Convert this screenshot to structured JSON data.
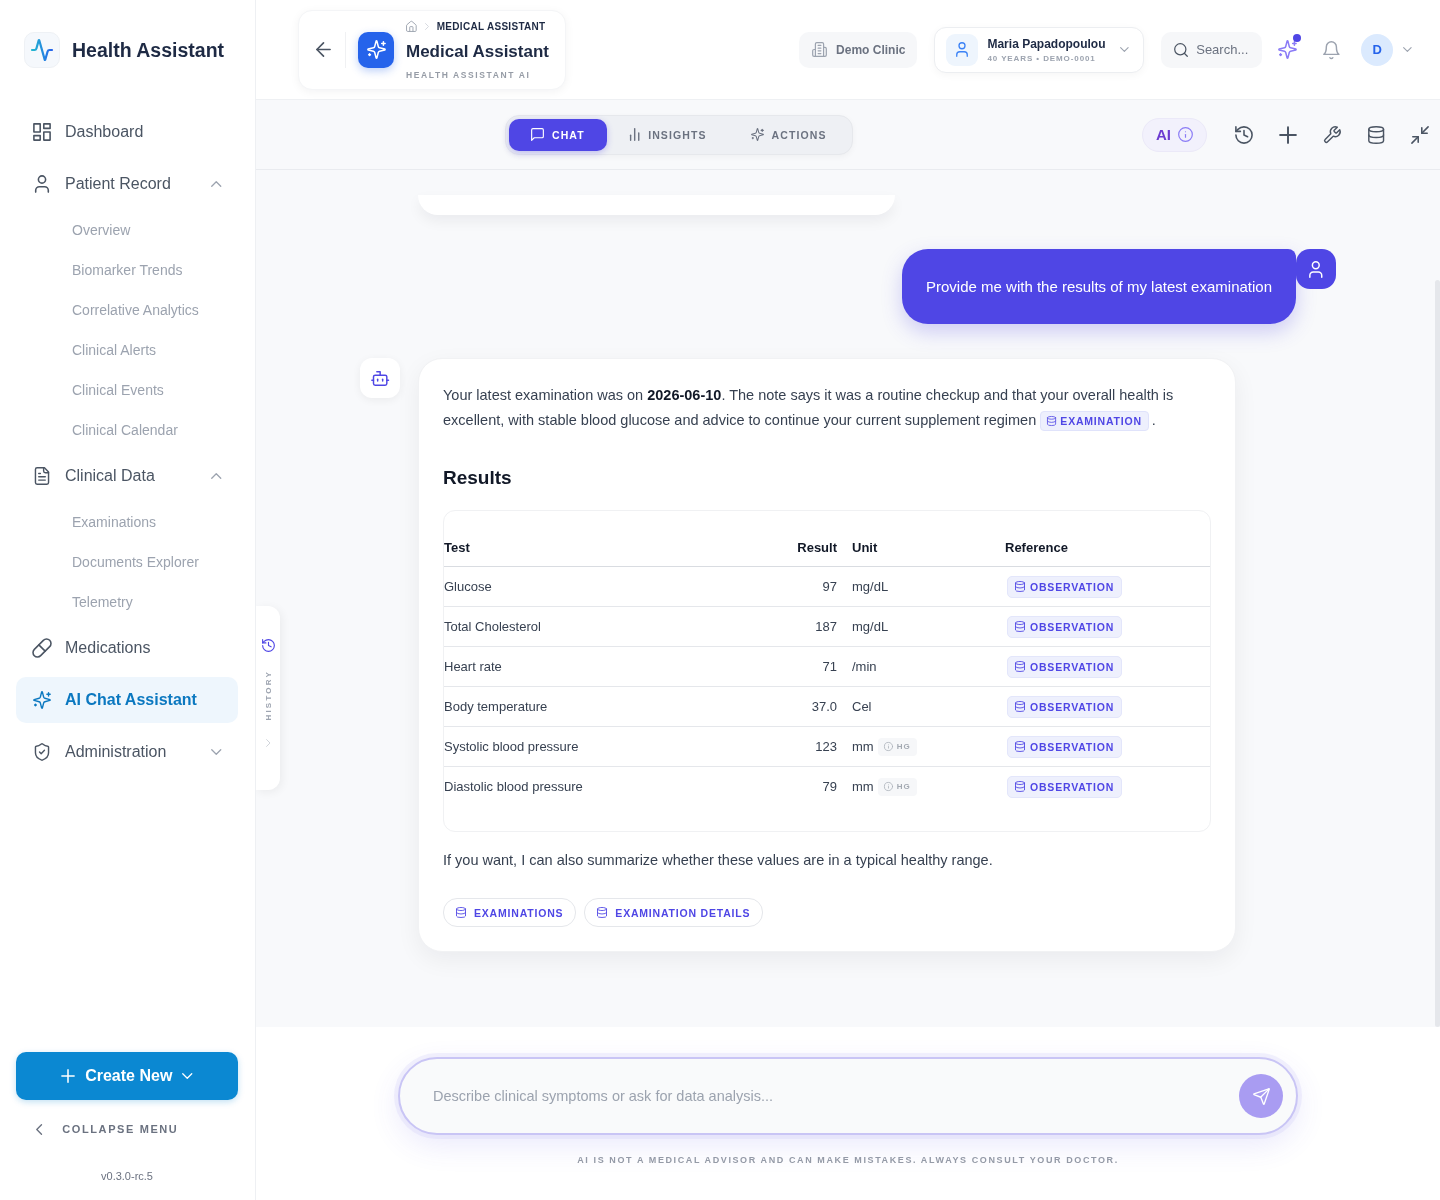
{
  "sidebar": {
    "brand": "Health Assistant",
    "nav": [
      {
        "kind": "link",
        "label": "Dashboard",
        "selected": false
      },
      {
        "kind": "group",
        "label": "Patient Record",
        "selected": false,
        "expanded": true,
        "children": [
          {
            "label": "Overview",
            "selected": false
          },
          {
            "label": "Biomarker Trends",
            "selected": false
          },
          {
            "label": "Correlative Analytics",
            "selected": false
          },
          {
            "label": "Clinical Alerts",
            "selected": false
          },
          {
            "label": "Clinical Events",
            "selected": false
          },
          {
            "label": "Clinical Calendar",
            "selected": false
          }
        ]
      },
      {
        "kind": "group",
        "label": "Clinical Data",
        "selected": false,
        "expanded": true,
        "children": [
          {
            "label": "Examinations",
            "selected": false
          },
          {
            "label": "Documents Explorer",
            "selected": false
          },
          {
            "label": "Telemetry",
            "selected": false
          }
        ]
      },
      {
        "kind": "link",
        "label": "Medications",
        "selected": false
      },
      {
        "kind": "link",
        "label": "AI Chat Assistant",
        "selected": true
      },
      {
        "kind": "group",
        "label": "Administration",
        "selected": false,
        "expanded": false
      }
    ],
    "create_button": "Create New",
    "collapse_label": "COLLAPSE MENU",
    "version": "v0.3.0-rc.5"
  },
  "header": {
    "breadcrumb": [
      "MEDICAL ASSISTANT"
    ],
    "title": "Medical Assistant",
    "subtitle": "HEALTH ASSISTANT AI",
    "clinic": "Demo Clinic",
    "patient": {
      "name": "Maria Papadopoulou",
      "details": "40 YEARS • DEMO-0001"
    },
    "search_label": "Search...",
    "ai_badge": true,
    "avatar_initial": "D"
  },
  "toolbar": {
    "tabs": [
      {
        "label": "CHAT",
        "selected": true
      },
      {
        "label": "INSIGHTS",
        "selected": false
      },
      {
        "label": "ACTIONS",
        "selected": false
      }
    ],
    "ai_label": "AI"
  },
  "history_tab": {
    "label": "HISTORY"
  },
  "chat": {
    "messages": [
      {
        "kind": "user",
        "text": "Provide me with the results of my latest examination"
      },
      {
        "kind": "assistant",
        "text": "Your latest examination was on **2026-06-10**. The note says it was a routine checkup and that your overall health is excellent, with stable blood glucose and advice to continue your current supplement regimen",
        "source": "EXAMINATION",
        "text_end": ".",
        "heading": "Results",
        "table": {
          "columns": [
            "Test",
            "Result",
            "Unit",
            "Reference"
          ],
          "rows": [
            {
              "test": "Glucose",
              "result": "97",
              "unit": "mg/dL",
              "reference": "OBSERVATION"
            },
            {
              "test": "Total Cholesterol",
              "result": "187",
              "unit": "mg/dL",
              "reference": "OBSERVATION"
            },
            {
              "test": "Heart rate",
              "result": "71",
              "unit": "/min",
              "reference": "OBSERVATION"
            },
            {
              "test": "Body temperature",
              "result": "37.0",
              "unit": "Cel",
              "reference": "OBSERVATION"
            },
            {
              "test": "Systolic blood pressure",
              "result": "123",
              "unit": "mm",
              "unit_tag": "HG",
              "reference": "OBSERVATION"
            },
            {
              "test": "Diastolic blood pressure",
              "result": "79",
              "unit": "mm",
              "unit_tag": "HG",
              "reference": "OBSERVATION"
            }
          ]
        },
        "closing": "If you want, I can also summarize whether these values are in a typical healthy range.",
        "links": [
          "EXAMINATIONS",
          "EXAMINATION DETAILS"
        ]
      }
    ]
  },
  "composer": {
    "placeholder": "Describe clinical symptoms or ask for data analysis...",
    "disclaimer": "AI IS NOT A MEDICAL ADVISOR AND CAN MAKE MISTAKES. ALWAYS CONSULT YOUR DOCTOR."
  }
}
